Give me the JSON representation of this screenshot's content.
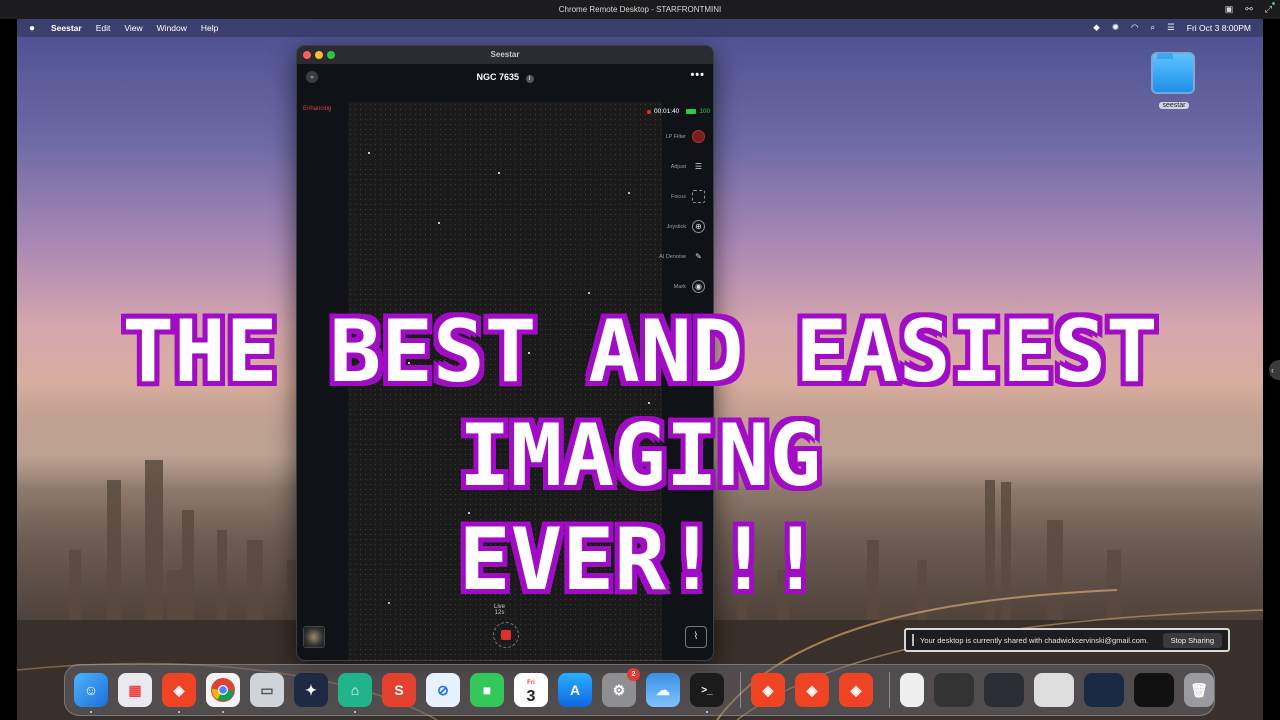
{
  "remote_desktop": {
    "title": "Chrome Remote Desktop - STARFRONTMINI"
  },
  "menubar": {
    "app_name": "Seestar",
    "items": [
      "Edit",
      "View",
      "Window",
      "Help"
    ],
    "clock": "Fri Oct 3  8:00PM"
  },
  "desktop": {
    "folder_label": "seestar"
  },
  "seestar_window": {
    "title": "Seestar",
    "target_name": "NGC 7635",
    "status": "Enhancing",
    "timer": "00:01:40",
    "battery": "100",
    "tools": [
      {
        "label": "LP Filter",
        "icon": "lp-filter-toggle-icon"
      },
      {
        "label": "Adjust",
        "icon": "sliders-icon"
      },
      {
        "label": "Focus",
        "icon": "focus-icon"
      },
      {
        "label": "Joystick",
        "icon": "joystick-icon"
      },
      {
        "label": "AI Denoise",
        "icon": "magic-wand-icon"
      },
      {
        "label": "Mark",
        "icon": "target-mark-icon"
      }
    ],
    "live_label": "Live",
    "live_time": "12s"
  },
  "share_bar": {
    "message": "Your desktop is currently shared with chadwickcervinski@gmail.com.",
    "stop_label": "Stop Sharing"
  },
  "overlay": {
    "line1": "THE BEST AND EASIEST",
    "line2": "IMAGING",
    "line3": "EVER!!!"
  },
  "dock": {
    "settings_badge": "2",
    "calendar_day": "3",
    "calendar_weekday": "Fri",
    "apps": [
      "finder-icon",
      "launchpad-icon",
      "anydesk-icon",
      "chrome-icon",
      "preview-icon",
      "stellarium-icon",
      "seestar-app-icon",
      "anydesk-s-icon",
      "safari-icon",
      "facetime-icon",
      "calendar-icon",
      "app-store-icon",
      "system-settings-icon",
      "weather-icon",
      "terminal-icon"
    ]
  },
  "colors": {
    "overlay_text": "#ffffff",
    "overlay_outline": "#a10dc4",
    "record_red": "#e0302a",
    "battery_green": "#2ecc40"
  }
}
